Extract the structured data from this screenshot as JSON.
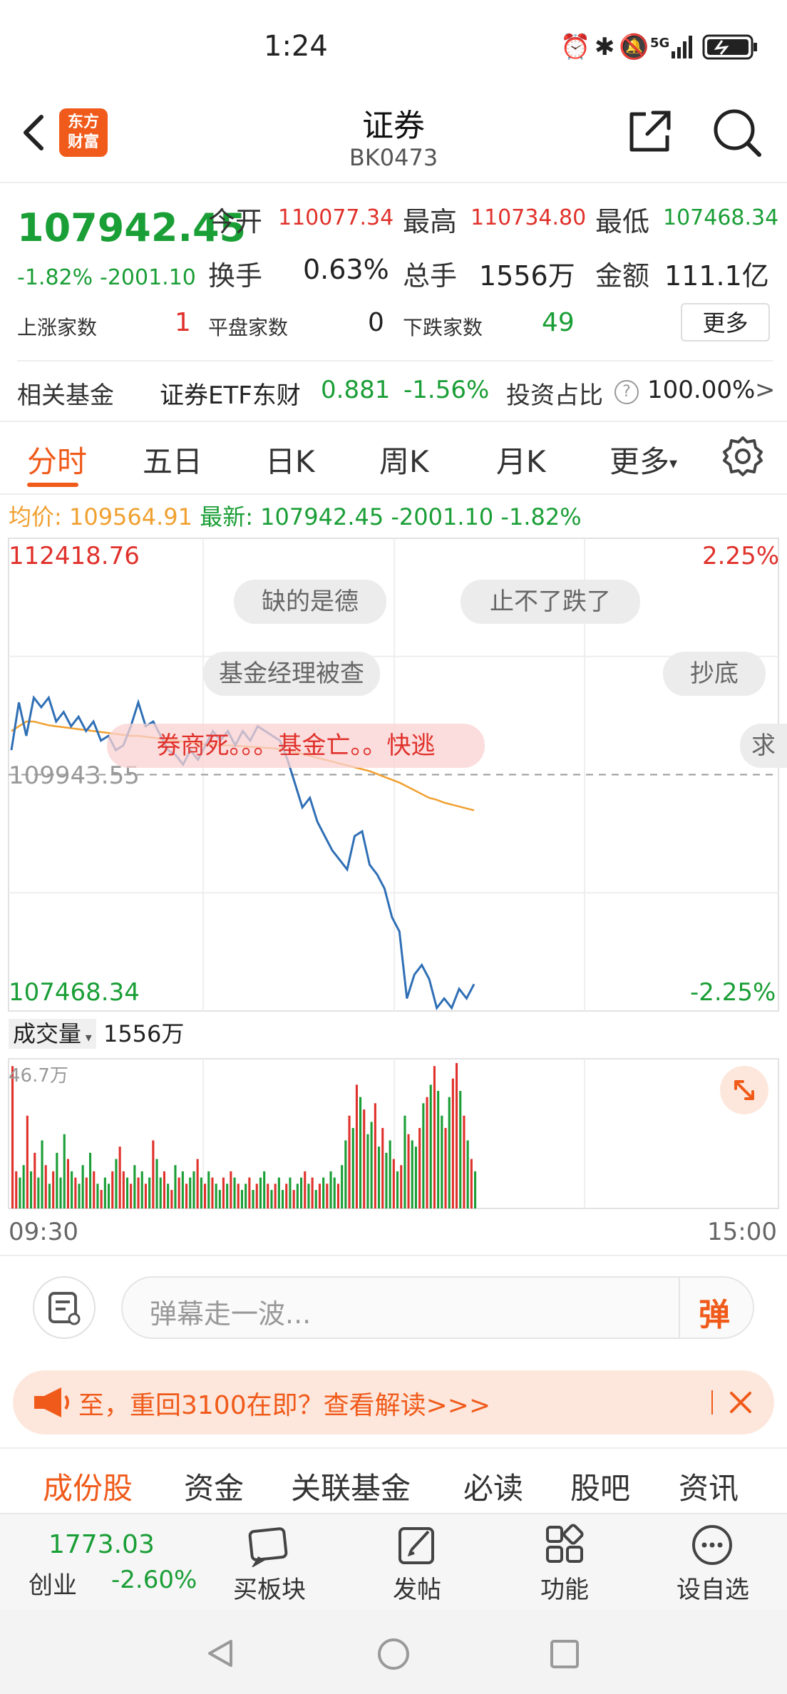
{
  "status_bar": {
    "time": "1:24",
    "network": "5G"
  },
  "header": {
    "title": "证券",
    "code": "BK0473",
    "logo_line1": "东方",
    "logo_line2": "财富"
  },
  "quote": {
    "price": "107942.45",
    "change_pct": "-1.82%",
    "change_amt": "-2001.10",
    "open_label": "今开",
    "open": "110077.34",
    "high_label": "最高",
    "high": "110734.80",
    "low_label": "最低",
    "low": "107468.34",
    "turnover_label": "换手",
    "turnover": "0.63%",
    "volume_label": "总手",
    "volume": "1556万",
    "amount_label": "金额",
    "amount": "111.1亿",
    "up_label": "上涨家数",
    "up": "1",
    "flat_label": "平盘家数",
    "flat": "0",
    "down_label": "下跌家数",
    "down": "49",
    "more_label": "更多"
  },
  "fund": {
    "label": "相关基金",
    "name": "证券ETF东财",
    "price": "0.881",
    "change": "-1.56%",
    "ratio_label": "投资占比",
    "ratio": "100.00%",
    "arrow": ">"
  },
  "chart_tabs": [
    "分时",
    "五日",
    "日K",
    "周K",
    "月K",
    "更多"
  ],
  "chart_info": {
    "avg_label": "均价:",
    "avg": "109564.91",
    "latest_label": "最新:",
    "latest": "107942.45",
    "latest_chg": "-2001.10",
    "latest_pct": "-1.82%"
  },
  "chart_labels": {
    "top_value": "112418.76",
    "top_pct": "2.25%",
    "mid_value": "109943.55",
    "bottom_value": "107468.34",
    "bottom_pct": "-2.25%",
    "vol_max": "46.7万",
    "start_time": "09:30",
    "end_time": "15:00"
  },
  "barrages": [
    "缺的是德",
    "止不了跌了",
    "基金经理被查",
    "抄底",
    "券商死。。。基金亡。。快逃",
    "求"
  ],
  "volume_header": {
    "label": "成交量",
    "value": "1556万"
  },
  "barrage_input": {
    "placeholder": "弹幕走一波...",
    "send_label": "弹"
  },
  "notice": {
    "text": "至，重回3100在即？查看解读>>>"
  },
  "stock_tabs": [
    "成份股",
    "资金",
    "关联基金",
    "必读",
    "股吧",
    "资讯"
  ],
  "bottom_bar": {
    "index_value": "1773.03",
    "index_name": "创业",
    "index_pct": "-2.60%",
    "items": [
      "买板块",
      "发帖",
      "功能",
      "设自选"
    ]
  },
  "colors": {
    "up": "#e0312b",
    "down": "#1a9e36",
    "accent": "#f05a1a",
    "price_line": "#2f6fb5",
    "avg_line": "#f0a030"
  },
  "chart_data": {
    "type": "line",
    "ylim": [
      107468.34,
      112418.76
    ],
    "reference": 109943.55,
    "price_series": [
      110200,
      110700,
      110350,
      110750,
      110650,
      110750,
      110500,
      110600,
      110450,
      110550,
      110400,
      110500,
      110300,
      110350,
      110200,
      110250,
      110450,
      110700,
      110450,
      110500,
      110350,
      110200,
      110150,
      110050,
      110200,
      110100,
      110250,
      110400,
      110300,
      110400,
      110250,
      110400,
      110300,
      110450,
      110400,
      110350,
      110300,
      110100,
      109850,
      109600,
      109700,
      109450,
      109300,
      109150,
      109050,
      108950,
      109300,
      109350,
      109000,
      108900,
      108750,
      108450,
      108300,
      107600,
      107850,
      107950,
      107800,
      107500,
      107600,
      107500,
      107700,
      107600,
      107750
    ],
    "avg_series": [
      110400,
      110450,
      110500,
      110500,
      110480,
      110460,
      110450,
      110440,
      110430,
      110420,
      110410,
      110400,
      110390,
      110380,
      110370,
      110360,
      110350,
      110350,
      110340,
      110330,
      110320,
      110310,
      110300,
      110290,
      110280,
      110270,
      110260,
      110255,
      110250,
      110250,
      110245,
      110240,
      110235,
      110230,
      110225,
      110220,
      110210,
      110200,
      110180,
      110160,
      110140,
      110120,
      110100,
      110080,
      110060,
      110040,
      110020,
      110000,
      109980,
      109950,
      109920,
      109890,
      109860,
      109820,
      109780,
      109740,
      109700,
      109680,
      109650,
      109630,
      109610,
      109590,
      109570
    ],
    "volume_series": [
      46,
      12,
      10,
      14,
      30,
      12,
      18,
      10,
      22,
      14,
      8,
      12,
      18,
      10,
      24,
      16,
      12,
      10,
      8,
      14,
      10,
      18,
      12,
      8,
      6,
      10,
      8,
      12,
      16,
      20,
      12,
      10,
      8,
      14,
      10,
      12,
      8,
      10,
      22,
      16,
      10,
      12,
      8,
      6,
      14,
      10,
      12,
      8,
      10,
      12,
      16,
      10,
      8,
      12,
      10,
      8,
      6,
      10,
      8,
      12,
      10,
      8,
      6,
      8,
      10,
      6,
      8,
      10,
      12,
      8,
      6,
      8,
      10,
      6,
      8,
      10,
      6,
      8,
      10,
      12,
      8,
      10,
      6,
      8,
      10,
      8,
      12,
      10,
      8,
      14,
      22,
      30,
      26,
      40,
      36,
      32,
      24,
      28,
      34,
      20,
      26,
      18,
      22,
      16,
      12,
      14,
      30,
      24,
      22,
      20,
      26,
      34,
      36,
      40,
      46,
      38,
      30,
      26,
      36,
      42,
      47,
      38,
      30,
      22,
      16,
      12
    ],
    "volume_up": [
      true,
      true,
      false,
      false,
      true,
      false,
      true,
      false,
      false,
      true,
      false,
      true,
      false,
      false,
      false,
      true,
      false,
      true,
      false,
      false,
      true,
      false,
      true,
      false,
      true,
      false,
      false,
      true,
      false,
      true,
      true,
      false,
      true,
      false,
      true,
      false,
      true,
      false,
      true,
      false,
      false,
      true,
      false,
      true,
      false,
      true,
      false,
      true,
      false,
      false,
      true,
      false,
      true,
      false,
      true,
      false,
      false,
      true,
      false,
      true,
      false,
      true,
      false,
      false,
      true,
      false,
      true,
      false,
      false,
      true,
      false,
      true,
      false,
      false,
      true,
      false,
      true,
      false,
      false,
      true,
      false,
      true,
      false,
      true,
      false,
      true,
      false,
      false,
      true,
      false,
      false,
      true,
      false,
      true,
      false,
      true,
      false,
      false,
      true,
      false,
      true,
      false,
      false,
      true,
      false,
      true,
      false,
      true,
      false,
      false,
      true,
      false,
      true,
      false,
      true,
      false,
      false,
      true,
      false,
      true,
      true,
      false,
      true,
      false,
      true,
      false
    ]
  }
}
